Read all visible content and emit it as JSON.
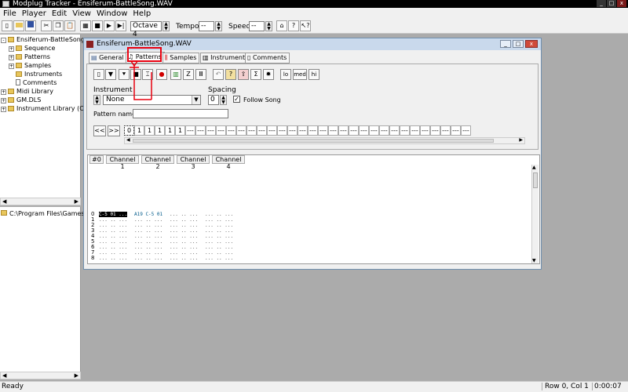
{
  "window": {
    "title": "Modplug Tracker - Ensiferum-BattleSong.WAV",
    "minimize_glyph": "_",
    "maximize_glyph": "□",
    "close_glyph": "x"
  },
  "menu": [
    "File",
    "Player",
    "Edit",
    "View",
    "Window",
    "Help"
  ],
  "toolbar": {
    "octave_value": "Octave 4",
    "tempo_label": "Tempo:",
    "tempo_value": "--",
    "speed_label": "Speed:",
    "speed_value": "--"
  },
  "tree": {
    "root": "Ensiferum-BattleSong",
    "children": [
      "Sequence",
      "Patterns",
      "Samples",
      "Instruments",
      "Comments"
    ],
    "midi_library": "Midi Library",
    "gm_dls": "GM.DLS",
    "instrument_library": "Instrument Library (C:\\Prog"
  },
  "folder": {
    "path": "C:\\Program Files\\Games\\Tra"
  },
  "child_window": {
    "title": "Ensiferum-BattleSong.WAV",
    "tabs": [
      "General",
      "Patterns",
      "Samples",
      "Instruments",
      "Comments"
    ],
    "quality_buttons": [
      "lo",
      "med",
      "hi"
    ],
    "instrument_label": "Instrument",
    "instrument_value": "None",
    "spacing_label": "Spacing",
    "spacing_value": "0",
    "follow_song_label": "Follow Song",
    "follow_song_checked": true,
    "pattern_name_label": "Pattern name:",
    "pattern_name_value": "",
    "order_nav": [
      "<<",
      ">>"
    ],
    "order_list": [
      "0",
      "1",
      "1",
      "1",
      "1",
      "1",
      "---",
      "---",
      "---",
      "---",
      "---",
      "---",
      "---",
      "---",
      "---",
      "---",
      "---",
      "---",
      "---",
      "---",
      "---",
      "---",
      "---",
      "---",
      "---",
      "---",
      "---",
      "---",
      "---",
      "---",
      "---",
      "---",
      "---",
      "---"
    ],
    "pattern_columns": [
      "#0",
      "Channel 1",
      "Channel 2",
      "Channel 3",
      "Channel 4"
    ],
    "pattern_rows": [
      {
        "num": "0",
        "ch1": "C-5 01 ...",
        "ch2": "A19 C-5 01",
        "ch3": "... .. ...",
        "ch4": "... .. ..."
      },
      {
        "num": "1",
        "ch1": "... .. ...",
        "ch2": "... .. ...",
        "ch3": "... .. ...",
        "ch4": "... .. ..."
      },
      {
        "num": "2",
        "ch1": "... .. ...",
        "ch2": "... .. ...",
        "ch3": "... .. ...",
        "ch4": "... .. ..."
      },
      {
        "num": "3",
        "ch1": "... .. ...",
        "ch2": "... .. ...",
        "ch3": "... .. ...",
        "ch4": "... .. ..."
      },
      {
        "num": "4",
        "ch1": "... .. ...",
        "ch2": "... .. ...",
        "ch3": "... .. ...",
        "ch4": "... .. ..."
      },
      {
        "num": "5",
        "ch1": "... .. ...",
        "ch2": "... .. ...",
        "ch3": "... .. ...",
        "ch4": "... .. ..."
      },
      {
        "num": "6",
        "ch1": "... .. ...",
        "ch2": "... .. ...",
        "ch3": "... .. ...",
        "ch4": "... .. ..."
      },
      {
        "num": "7",
        "ch1": "... .. ...",
        "ch2": "... .. ...",
        "ch3": "... .. ...",
        "ch4": "... .. ..."
      },
      {
        "num": "8",
        "ch1": "... .. ...",
        "ch2": "... .. ...",
        "ch3": "... .. ...",
        "ch4": "... .. ..."
      }
    ]
  },
  "status": {
    "left": "Ready",
    "position": "Row 0, Col 1",
    "time": "0:00:07"
  },
  "colors": {
    "annotation": "#e8000f",
    "workspace": "#ababab",
    "child_title": "#c9d9ec",
    "record": "#d00000"
  },
  "icons": [
    "new-file-icon",
    "open-folder-icon",
    "save-icon",
    "cut-icon",
    "copy-icon",
    "paste-icon",
    "midi-record-icon",
    "stop-icon",
    "play-icon",
    "play-from-start-icon",
    "metronome-icon",
    "help-icon",
    "context-help-icon"
  ]
}
